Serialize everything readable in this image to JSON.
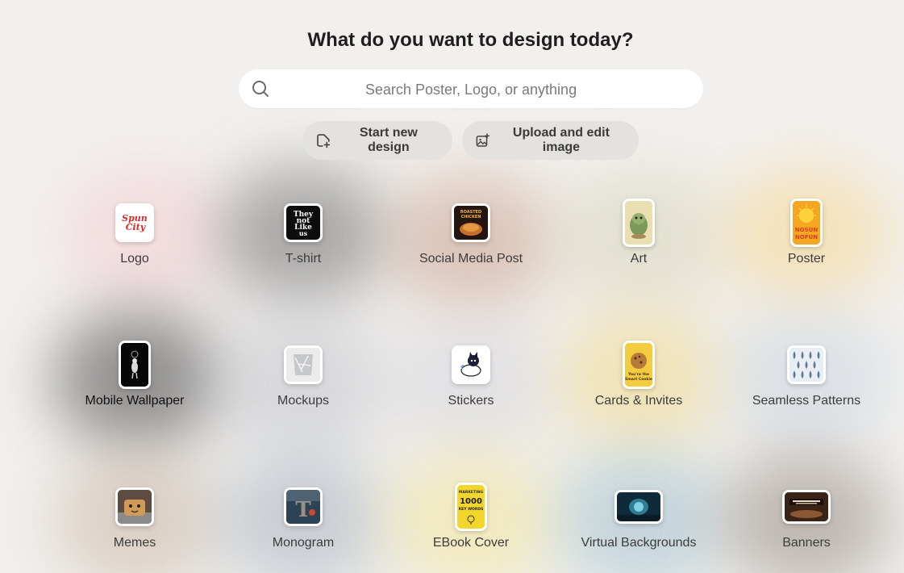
{
  "header": {
    "title": "What do you want to design today?"
  },
  "search": {
    "placeholder": "Search Poster, Logo, or anything",
    "value": ""
  },
  "actions": {
    "start_new_design": "Start new design",
    "upload_and_edit_image": "Upload and edit image"
  },
  "categories": [
    {
      "label": "Logo",
      "thumb_text": "Spun City",
      "glow": "#f4c8cc"
    },
    {
      "label": "T-shirt",
      "thumb_text": "They not Like us",
      "glow": "#8a8a8a"
    },
    {
      "label": "Social Media Post",
      "thumb_text": "Roasted Chicken",
      "glow": "#c9a089"
    },
    {
      "label": "Art",
      "thumb_text": "",
      "glow": "#d6d2b6"
    },
    {
      "label": "Poster",
      "thumb_text": "NOSUN NOFUN",
      "glow": "#f6d48d"
    },
    {
      "label": "Mobile Wallpaper",
      "thumb_text": "",
      "glow": "#5a5a5a"
    },
    {
      "label": "Mockups",
      "thumb_text": "",
      "glow": "#c9cbd0"
    },
    {
      "label": "Stickers",
      "thumb_text": "",
      "glow": "#d8d8dc"
    },
    {
      "label": "Cards & Invites",
      "thumb_text": "You're the Smart Cookie",
      "glow": "#f1d98c"
    },
    {
      "label": "Seamless Patterns",
      "thumb_text": "",
      "glow": "#cdd6e0"
    },
    {
      "label": "Memes",
      "thumb_text": "",
      "glow": "#c9b7a8"
    },
    {
      "label": "Monogram",
      "thumb_text": "",
      "glow": "#aeb6c1"
    },
    {
      "label": "EBook Cover",
      "thumb_text": "MARKETING 1000 KEY WORDS",
      "glow": "#f3e69a"
    },
    {
      "label": "Virtual Backgrounds",
      "thumb_text": "",
      "glow": "#a8c4cf"
    },
    {
      "label": "Banners",
      "thumb_text": "",
      "glow": "#9b8f86"
    }
  ],
  "icons": {
    "search": "search-icon",
    "start": "new-design-icon",
    "upload": "image-upload-icon"
  }
}
